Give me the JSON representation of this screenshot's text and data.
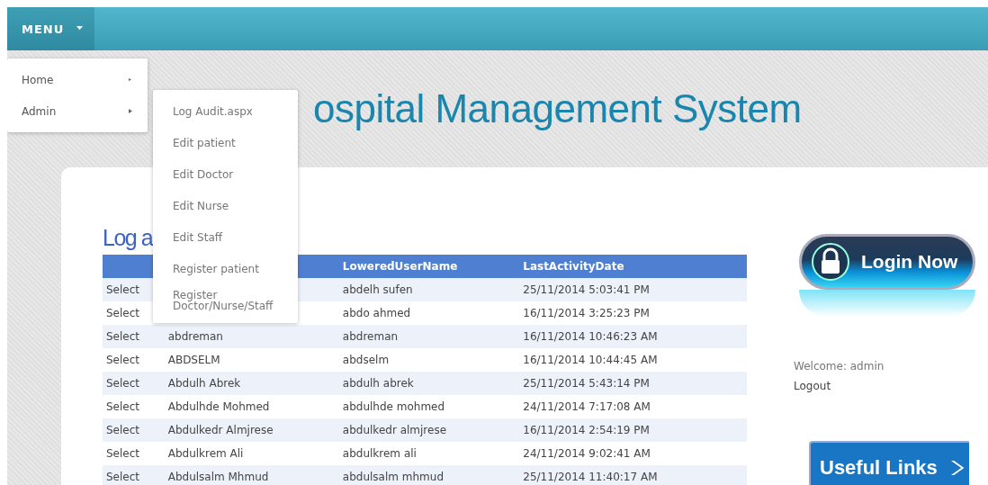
{
  "top_bar": {
    "menu_label": "MENU"
  },
  "menu": {
    "items": [
      {
        "label": "Home",
        "expanded": false
      },
      {
        "label": "Admin",
        "expanded": true
      }
    ],
    "submenu": [
      "Log Audit.aspx",
      "Edit patient",
      "Edit Doctor",
      "Edit Nurse",
      "Edit Staff",
      "Register patient",
      "Register Doctor/Nurse/Staff"
    ]
  },
  "header": {
    "title": "ospital Management System"
  },
  "content": {
    "heading": "Log a",
    "table": {
      "columns": [
        "",
        null,
        "LoweredUserName",
        "LastActivityDate"
      ],
      "rows": [
        {
          "action": "Select",
          "user_name": null,
          "lowered_user_name": "abdelh sufen",
          "last_activity_date": "25/11/2014 5:03:41 PM"
        },
        {
          "action": "Select",
          "user_name": null,
          "lowered_user_name": "abdo ahmed",
          "last_activity_date": "16/11/2014 3:25:23 PM"
        },
        {
          "action": "Select",
          "user_name": "abdreman",
          "lowered_user_name": "abdreman",
          "last_activity_date": "16/11/2014 10:46:23 AM"
        },
        {
          "action": "Select",
          "user_name": "ABDSELM",
          "lowered_user_name": "abdselm",
          "last_activity_date": "16/11/2014 10:44:45 AM"
        },
        {
          "action": "Select",
          "user_name": "Abdulh Abrek",
          "lowered_user_name": "abdulh abrek",
          "last_activity_date": "25/11/2014 5:43:14 PM"
        },
        {
          "action": "Select",
          "user_name": "Abdulhde Mohmed",
          "lowered_user_name": "abdulhde mohmed",
          "last_activity_date": "24/11/2014 7:17:08 AM"
        },
        {
          "action": "Select",
          "user_name": "Abdulkedr Almjrese",
          "lowered_user_name": "abdulkedr almjrese",
          "last_activity_date": "16/11/2014 2:54:19 PM"
        },
        {
          "action": "Select",
          "user_name": "Abdulkrem Ali",
          "lowered_user_name": "abdulkrem ali",
          "last_activity_date": "24/11/2014 9:02:41 AM"
        },
        {
          "action": "Select",
          "user_name": "Abdulsalm Mhmud",
          "lowered_user_name": "abdulsalm mhmud",
          "last_activity_date": "25/11/2014 11:40:17 AM"
        }
      ]
    }
  },
  "sidebar": {
    "login_button": "Login Now",
    "welcome": "Welcome: admin",
    "logout": "Logout",
    "useful_links": "Useful Links"
  }
}
